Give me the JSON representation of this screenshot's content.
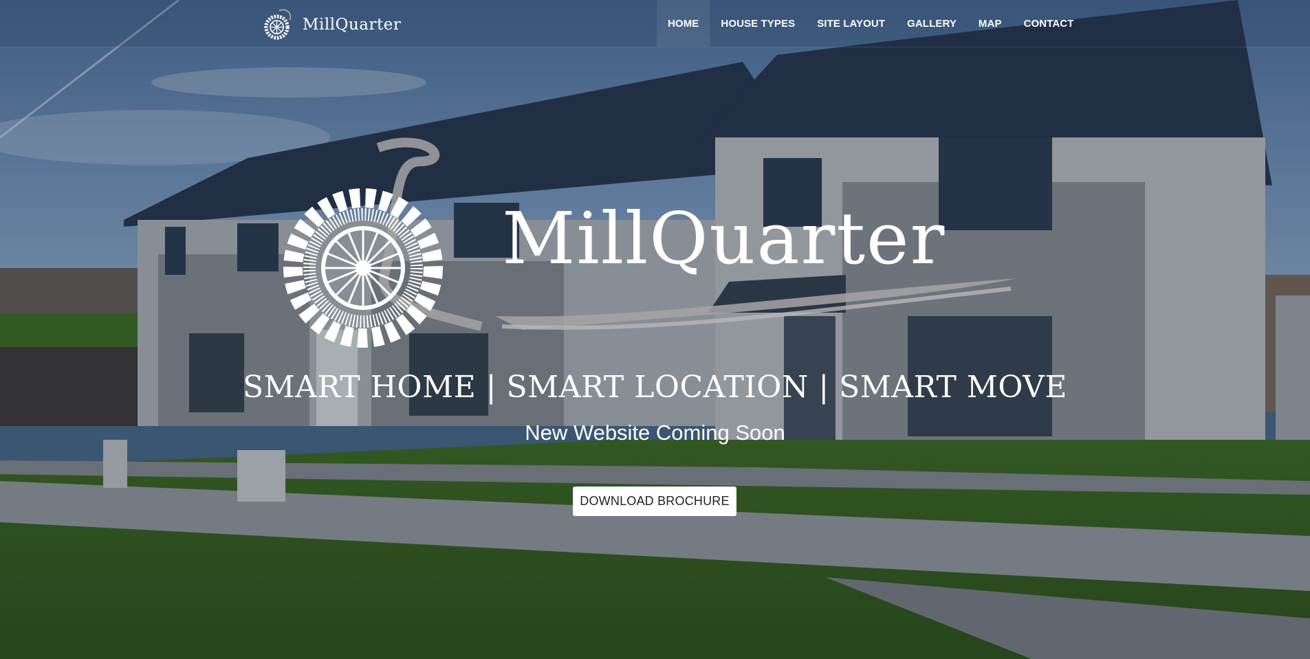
{
  "brand": {
    "name": "MillQuarter",
    "logo_icon": "water-wheel-icon"
  },
  "nav": {
    "items": [
      {
        "label": "HOME",
        "active": true
      },
      {
        "label": "HOUSE TYPES",
        "active": false
      },
      {
        "label": "SITE LAYOUT",
        "active": false
      },
      {
        "label": "GALLERY",
        "active": false
      },
      {
        "label": "MAP",
        "active": false
      },
      {
        "label": "CONTACT",
        "active": false
      }
    ]
  },
  "hero": {
    "wordmark": "MillQuarter",
    "tagline": "SMART HOME | SMART LOCATION | SMART MOVE",
    "subtitle": "New Website Coming Soon",
    "cta_label": "DOWNLOAD BROCHURE",
    "background_image": "houses-photo"
  },
  "colors": {
    "sky": "#5b7ea6",
    "roof": "#2a3850",
    "wall": "#b9bcc0",
    "grass": "#3f6e1e",
    "accent_swoosh": "#9a9a9a",
    "button_bg": "#ffffff",
    "button_text": "#222222"
  }
}
